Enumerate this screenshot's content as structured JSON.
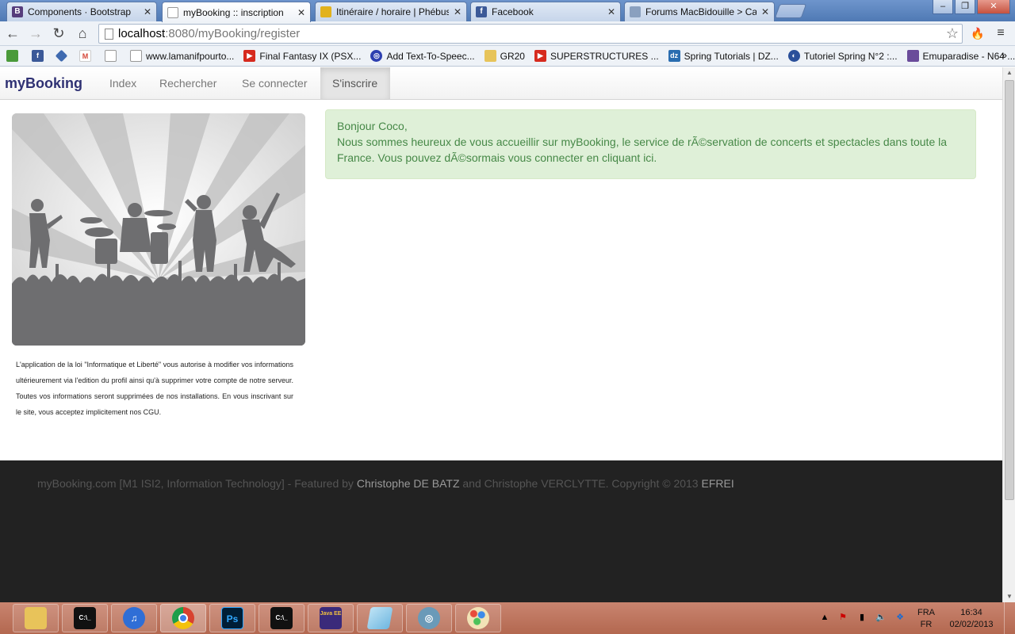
{
  "browser": {
    "tabs": [
      {
        "label": "Components · Bootstrap",
        "favicon": "B",
        "favicon_color": "#563d7c"
      },
      {
        "label": "myBooking :: inscription",
        "favicon": "",
        "favicon_color": "#ffffff"
      },
      {
        "label": "Itinéraire / horaire | Phébus",
        "favicon": "",
        "favicon_color": "#e2b21c"
      },
      {
        "label": "Facebook",
        "favicon": "f",
        "favicon_color": "#3b5998"
      },
      {
        "label": "Forums MacBidouille > Ca",
        "favicon": "",
        "favicon_color": "#8aa0bf"
      }
    ],
    "url_host": "localhost",
    "url_rest": ":8080/myBooking/register",
    "bookmarks": [
      {
        "label": "",
        "icon": "",
        "color": "#4a9a3a"
      },
      {
        "label": "",
        "icon": "f",
        "color": "#3b5998"
      },
      {
        "label": "",
        "icon": "",
        "color": "#3f6ab0"
      },
      {
        "label": "",
        "icon": "M",
        "color": "#d44638"
      },
      {
        "label": "",
        "icon": "",
        "color": "#ffffff"
      },
      {
        "label": "www.lamanifpourto...",
        "icon": "",
        "color": "#ffffff"
      },
      {
        "label": "Final Fantasy IX (PSX...",
        "icon": "▶",
        "color": "#d62a1e"
      },
      {
        "label": "Add Text-To-Speec...",
        "icon": "◎",
        "color": "#2d3fb0"
      },
      {
        "label": "GR20",
        "icon": "",
        "color": "#e7c45a"
      },
      {
        "label": "SUPERSTRUCTURES ...",
        "icon": "▶",
        "color": "#d62a1e"
      },
      {
        "label": "Spring Tutorials | DZ...",
        "icon": "dz",
        "color": "#2a6db0"
      },
      {
        "label": "Tutoriel Spring N°2 :...",
        "icon": "◐",
        "color": "#2a4f9a"
      },
      {
        "label": "Emuparadise - N64 ...",
        "icon": "",
        "color": "#6a4b9a"
      }
    ]
  },
  "site": {
    "brand": "myBooking",
    "nav": [
      "Index",
      "Rechercher",
      "Se connecter",
      "S'inscrire"
    ],
    "active_nav": "S'inscrire",
    "alert_greeting": "Bonjour Coco,",
    "alert_message": "Nous sommes heureux de vous accueillir sur myBooking, le service de rÃ©servation de concerts et spectacles dans toute la France. Vous pouvez dÃ©sormais vous connecter en cliquant ici.",
    "legal_text": "L'application de la loi \"Informatique et Liberté\" vous autorise à modifier vos informations ultérieurement via l'edition du profil ainsi qu'à supprimer votre compte de notre serveur. Toutes vos informations seront supprimées de nos installations. En vous inscrivant sur le site, vous acceptez implicitement nos CGU.",
    "footer": {
      "prefix": "myBooking.com [M1 ISI2, Information Technology] - Featured by ",
      "author1": "Christophe DE BATZ",
      "middle": " and Christophe VERCLYTTE. Copyright © 2013 ",
      "school": "EFREI"
    }
  },
  "taskbar": {
    "apps": [
      {
        "name": "explorer",
        "glyph": "",
        "color": "#e8c35a"
      },
      {
        "name": "cmd",
        "glyph": "C:\\_",
        "color": "#111111"
      },
      {
        "name": "itunes",
        "glyph": "♫",
        "color": "#2f6ed6"
      },
      {
        "name": "chrome",
        "glyph": "",
        "color": "#d8412f"
      },
      {
        "name": "photoshop",
        "glyph": "Ps",
        "color": "#001e36"
      },
      {
        "name": "cmd2",
        "glyph": "C:\\_",
        "color": "#111111"
      },
      {
        "name": "javaee",
        "glyph": "Java EE",
        "color": "#3a2a7a"
      },
      {
        "name": "notepad",
        "glyph": "",
        "color": "#6fb7e0"
      },
      {
        "name": "app9",
        "glyph": "◎",
        "color": "#6a9ab8"
      },
      {
        "name": "paint",
        "glyph": "",
        "color": "#e3a94a"
      }
    ],
    "lang_top": "FRA",
    "lang_bottom": "FR",
    "time": "16:34",
    "date": "02/02/2013"
  }
}
